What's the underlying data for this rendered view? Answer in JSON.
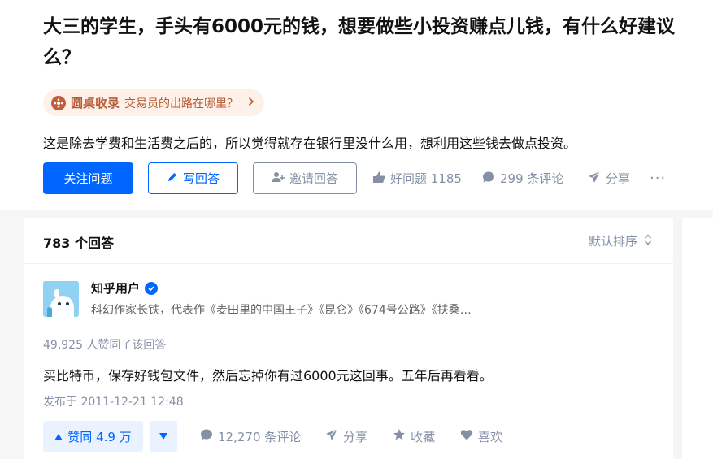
{
  "question": {
    "title": "大三的学生，手头有6000元的钱，想要做些小投资赚点儿钱，有什么好建议么？",
    "roundtable": {
      "label": "圆桌收录",
      "topic": "交易员的出路在哪里？"
    },
    "detail": "这是除去学费和生活费之后的，所以觉得就存在银行里没什么用，想利用这些钱去做点投资。",
    "actions": {
      "follow": "关注问题",
      "write": "写回答",
      "invite": "邀请回答",
      "good_question": "好问题 1185",
      "comments": "299 条评论",
      "share": "分享",
      "more": "···"
    }
  },
  "answers": {
    "count_label": "783 个回答",
    "sort_label": "默认排序",
    "first": {
      "author_name": "知乎用户",
      "author_bio": "科幻作家长铁，代表作《麦田里的中国王子》《昆仑》《674号公路》《扶桑…",
      "vote_summary": "49,925 人赞同了该回答",
      "content": "买比特币，保存好钱包文件，然后忘掉你有过6000元这回事。五年后再看看。",
      "time": "发布于 2011-12-21 12:48",
      "actions": {
        "upvote": "赞同 4.9 万",
        "comments": "12,270 条评论",
        "share": "分享",
        "collect": "收藏",
        "like": "喜欢"
      }
    }
  },
  "colors": {
    "brand_blue": "#0066ff",
    "meta_gray": "#8590a6",
    "roundtable_orange": "#b65c35"
  }
}
